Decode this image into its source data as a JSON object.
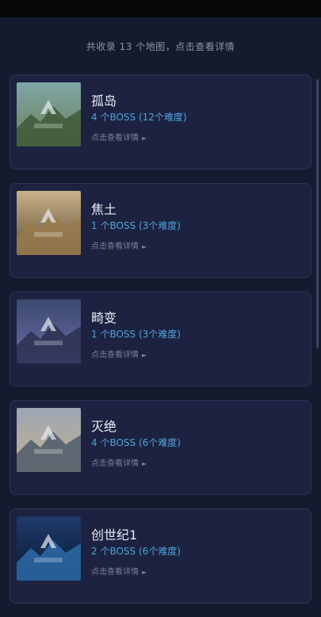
{
  "header": {
    "summary": "共收录 13 个地图，点击查看详情"
  },
  "maps": [
    {
      "name": "孤岛",
      "boss": "4 个BOSS (12个难度)",
      "detail": "点击查看详情",
      "thumb_icon": "the-island-cover",
      "thumb_colors": [
        "#7fa8a8",
        "#3e5a3a",
        "#6b7d55"
      ]
    },
    {
      "name": "焦土",
      "boss": "1 个BOSS (3个难度)",
      "detail": "点击查看详情",
      "thumb_icon": "scorched-earth-cover",
      "thumb_colors": [
        "#c9b38a",
        "#9a7a4e",
        "#5e4a34"
      ]
    },
    {
      "name": "畸变",
      "boss": "1 个BOSS (3个难度)",
      "detail": "点击查看详情",
      "thumb_icon": "aberration-cover",
      "thumb_colors": [
        "#3a4a6e",
        "#2a3050",
        "#6e6aa8"
      ]
    },
    {
      "name": "灭绝",
      "boss": "4 个BOSS (6个难度)",
      "detail": "点击查看详情",
      "thumb_icon": "extinction-cover",
      "thumb_colors": [
        "#9aa7b4",
        "#4e5a6a",
        "#c8b090"
      ]
    },
    {
      "name": "创世纪1",
      "boss": "2 个BOSS (6个难度)",
      "detail": "点击查看详情",
      "thumb_icon": "genesis-cover",
      "thumb_colors": [
        "#1d3a6a",
        "#2b6aa8",
        "#0c1a34"
      ]
    }
  ],
  "colors": {
    "background": "#141b2e",
    "card": "#1c2240",
    "accent": "#4fa3d9"
  }
}
